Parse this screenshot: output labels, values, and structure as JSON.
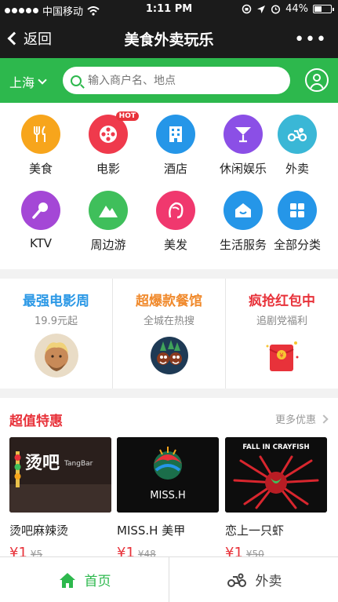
{
  "status_bar": {
    "carrier": "中国移动",
    "time": "1:11 PM",
    "battery": "44%",
    "battery_level": 0.44
  },
  "nav": {
    "back_label": "返回",
    "title": "美食外卖玩乐",
    "more": "•••"
  },
  "search": {
    "city": "上海",
    "placeholder": "输入商户名、地点"
  },
  "categories": [
    {
      "label": "美食",
      "icon": "fork-knife-icon",
      "color": "#f7a51c"
    },
    {
      "label": "电影",
      "icon": "film-reel-icon",
      "color": "#ef3a4c",
      "badge": "HOT"
    },
    {
      "label": "酒店",
      "icon": "building-icon",
      "color": "#2596e8"
    },
    {
      "label": "休闲娱乐",
      "icon": "cocktail-icon",
      "color": "#8b4fe6"
    },
    {
      "label": "外卖",
      "icon": "scooter-icon",
      "color": "#3ab7d6"
    },
    {
      "label": "KTV",
      "icon": "microphone-icon",
      "color": "#a447d6"
    },
    {
      "label": "周边游",
      "icon": "mountain-icon",
      "color": "#3fbf5b"
    },
    {
      "label": "美发",
      "icon": "hair-icon",
      "color": "#f0386e"
    },
    {
      "label": "生活服务",
      "icon": "home-service-icon",
      "color": "#2596e8"
    },
    {
      "label": "全部分类",
      "icon": "grid-icon",
      "color": "#2596e8"
    }
  ],
  "promos": [
    {
      "title": "最强电影周",
      "subtitle": "19.9元起",
      "color": "#2b98e6"
    },
    {
      "title": "超爆款餐馆",
      "subtitle": "全城在热搜",
      "color": "#f08a2d"
    },
    {
      "title": "疯抢红包中",
      "subtitle": "追剧党福利",
      "color": "#e8323a"
    }
  ],
  "deals": {
    "title": "超值特惠",
    "more": "更多优惠",
    "items": [
      {
        "name": "烫吧麻辣烫",
        "price": "¥1",
        "original": "¥5",
        "img_text": "烫吧"
      },
      {
        "name": "MISS.H 美甲",
        "price": "¥1",
        "original": "¥48",
        "img_text": "MISS.H"
      },
      {
        "name": "恋上一只虾",
        "price": "¥1",
        "original": "¥50",
        "img_text": "FALL IN CRAYFISH"
      }
    ]
  },
  "tabs": {
    "home": "首页",
    "delivery": "外卖"
  },
  "colors": {
    "accent_green": "#2db84d",
    "nav_dark": "#1b1b1b",
    "sale_red": "#e8323a"
  }
}
